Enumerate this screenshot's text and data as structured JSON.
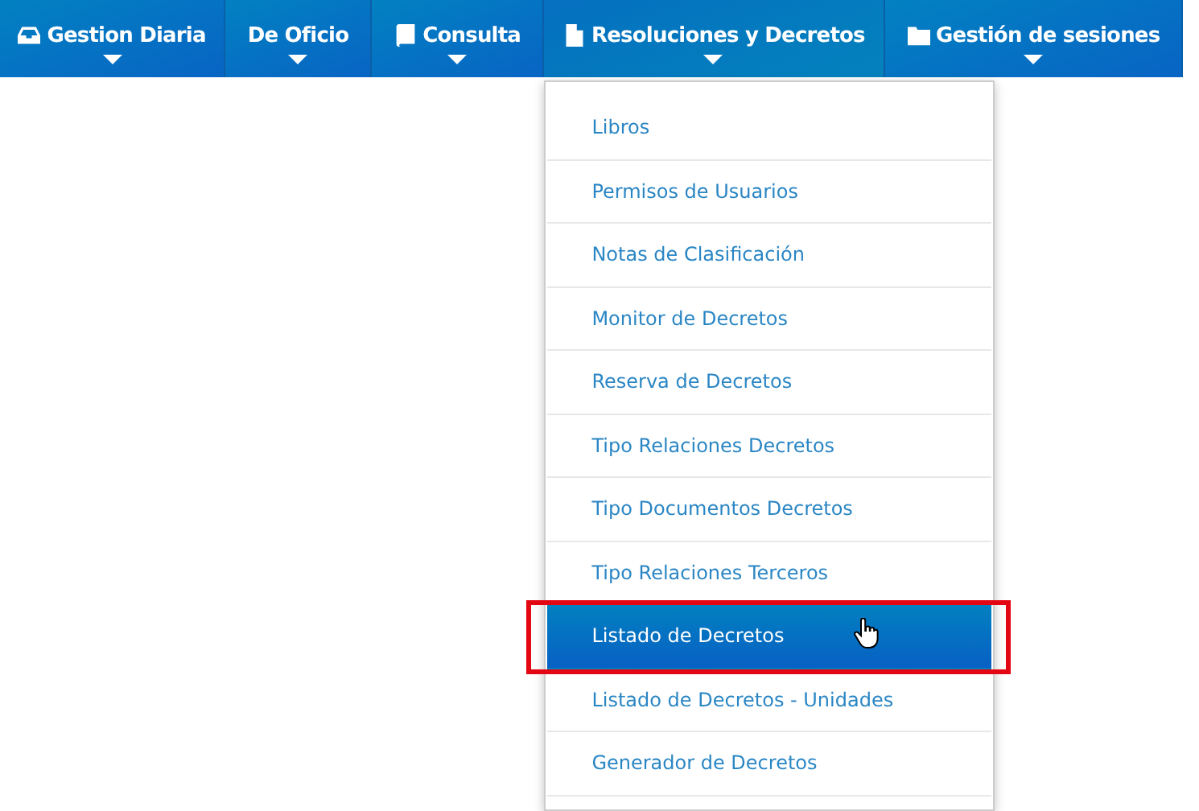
{
  "nav": [
    {
      "label": "Gestion Diaria",
      "kind": "inbox",
      "expanded": false
    },
    {
      "label": "De Oficio",
      "kind": "plain",
      "expanded": false
    },
    {
      "label": "Consulta",
      "kind": "book",
      "expanded": false
    },
    {
      "label": "Resoluciones y Decretos",
      "kind": "file",
      "expanded": true
    },
    {
      "label": "Gestión de sesiones",
      "kind": "folder",
      "expanded": false
    }
  ],
  "menu": [
    {
      "label": "Libros",
      "selected": false,
      "outlined": false
    },
    {
      "label": "Permisos de Usuarios",
      "selected": false,
      "outlined": false
    },
    {
      "label": "Notas de Clasificación",
      "selected": false,
      "outlined": false
    },
    {
      "label": "Monitor de Decretos",
      "selected": false,
      "outlined": false
    },
    {
      "label": "Reserva de Decretos",
      "selected": false,
      "outlined": false
    },
    {
      "label": "Tipo Relaciones Decretos",
      "selected": false,
      "outlined": false
    },
    {
      "label": "Tipo Documentos Decretos",
      "selected": false,
      "outlined": false
    },
    {
      "label": "Tipo Relaciones Terceros",
      "selected": false,
      "outlined": false
    },
    {
      "label": "Listado de Decretos",
      "selected": true,
      "outlined": true
    },
    {
      "label": "Listado de Decretos - Unidades",
      "selected": false,
      "outlined": false
    },
    {
      "label": "Generador de Decretos",
      "selected": false,
      "outlined": false
    }
  ]
}
